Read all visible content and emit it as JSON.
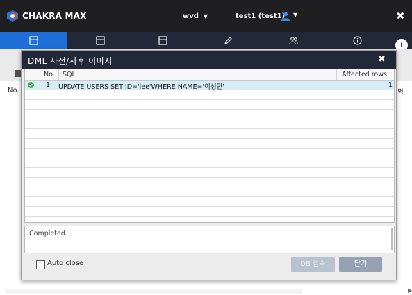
{
  "header": {
    "brand": "CHAKRA MAX",
    "db_select": "wvd",
    "user_select": "test1 (test1)",
    "close_glyph": "✖"
  },
  "tabs": [
    {
      "icon": "database-icon",
      "active": true
    },
    {
      "icon": "database-icon",
      "active": false
    },
    {
      "icon": "database-icon",
      "active": false
    },
    {
      "icon": "pencil-icon",
      "active": false
    },
    {
      "icon": "users-icon",
      "active": false
    },
    {
      "icon": "info-icon",
      "active": false
    }
  ],
  "side_badge": "i",
  "background": {
    "col_no": "No.",
    "col_right": "l 명"
  },
  "dialog": {
    "title": "DML 사전/사후 이미지",
    "close_glyph": "✖",
    "columns": {
      "no": "No.",
      "sql": "SQL",
      "affected": "Affected rows"
    },
    "rows": [
      {
        "no": "1",
        "sql": "UPDATE USERS SET ID='lee'WHERE NAME='이성민'",
        "affected": "1",
        "status": "ok"
      }
    ],
    "message": "Completed.",
    "auto_close_label": "Auto close",
    "auto_close_checked": false,
    "db_connect_button": "DB 접속",
    "close_button": "닫기"
  },
  "colors": {
    "topbar": "#1f1f22",
    "tabbar": "#232838",
    "active_tab": "#1f6fd8",
    "selected_row": "#d6ecf6",
    "ok_green": "#3aa33a"
  }
}
